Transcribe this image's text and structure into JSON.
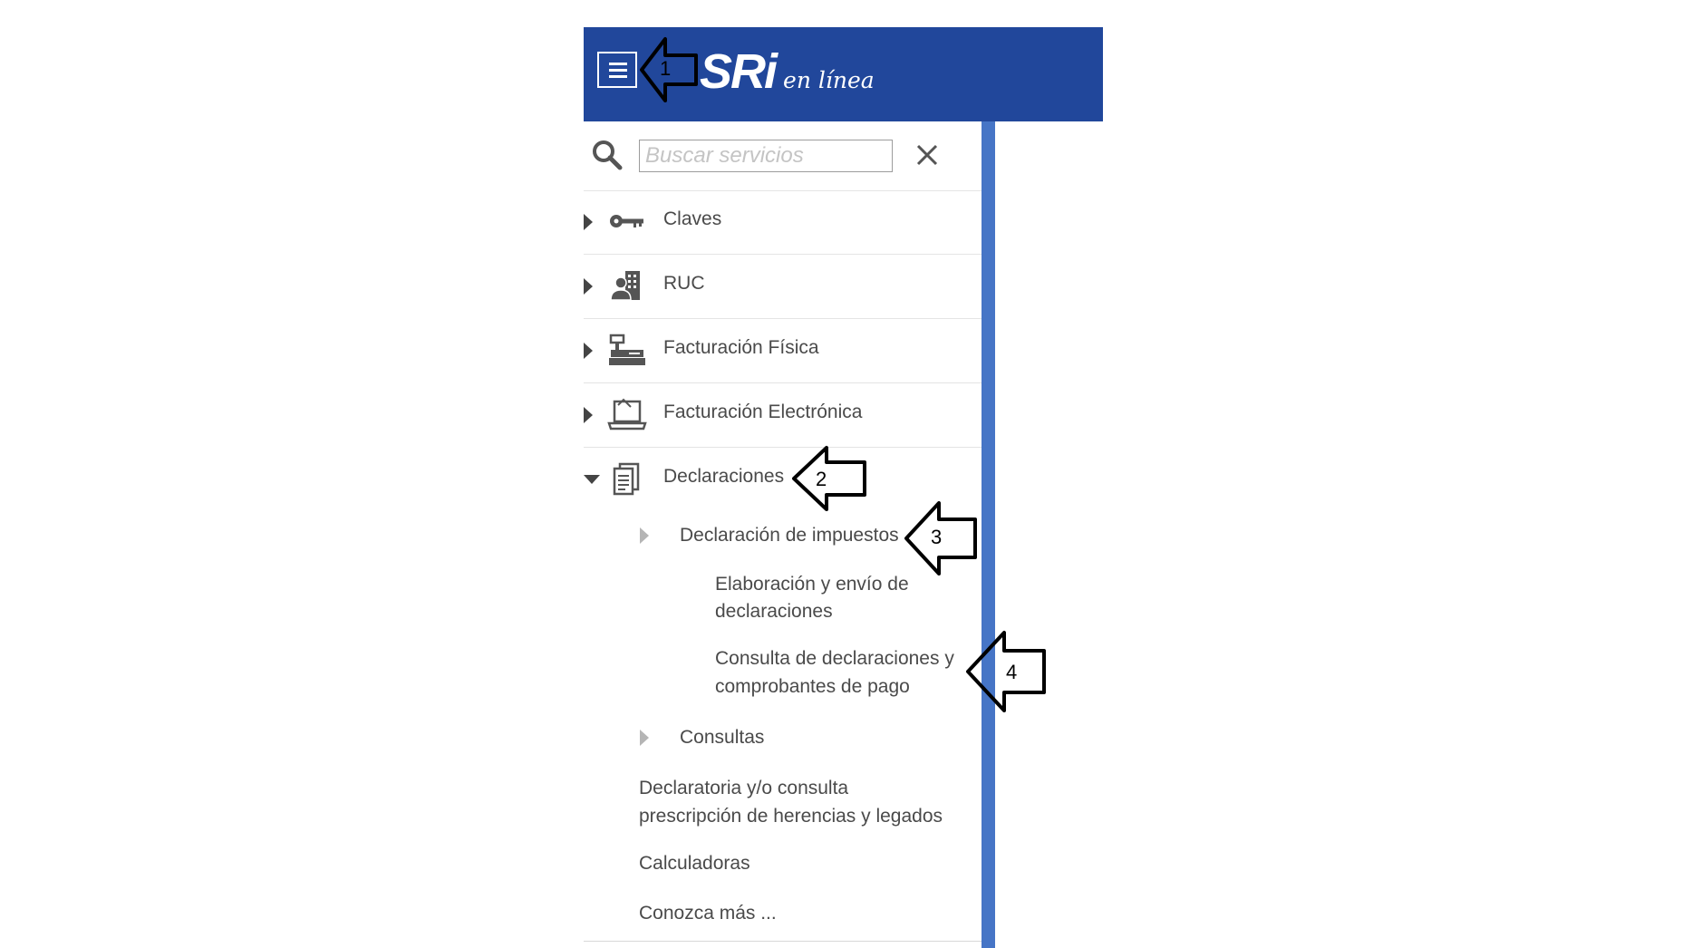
{
  "header": {
    "logo_main": "SRi",
    "logo_sub": "en línea",
    "menu_icon": "hamburger-menu-icon",
    "background_color": "#21479b"
  },
  "search": {
    "placeholder": "Buscar servicios",
    "value": "",
    "search_icon": "search-icon",
    "close_icon": "close-icon"
  },
  "menu": {
    "items": [
      {
        "label": "Claves",
        "icon": "key-icon",
        "expanded": false
      },
      {
        "label": "RUC",
        "icon": "person-building-icon",
        "expanded": false
      },
      {
        "label": "Facturación Física",
        "icon": "printer-icon",
        "expanded": false
      },
      {
        "label": "Facturación Electrónica",
        "icon": "laptop-icon",
        "expanded": false
      },
      {
        "label": "Declaraciones",
        "icon": "document-icon",
        "expanded": true
      }
    ],
    "declaraciones_sub": {
      "declaracion_impuestos": "Declaración de impuestos",
      "elaboracion_line1": "Elaboración y envío de",
      "elaboracion_line2": "declaraciones",
      "consulta_line1": "Consulta de declaraciones y",
      "consulta_line2": "comprobantes de pago",
      "consultas": "Consultas",
      "declaratoria_line1": "Declaratoria y/o consulta",
      "declaratoria_line2": "prescripción de herencias y legados",
      "calculadoras": "Calculadoras",
      "conozca": "Conozca más ..."
    }
  },
  "annotations": {
    "arrow1": "1",
    "arrow2": "2",
    "arrow3": "3",
    "arrow4": "4"
  },
  "colors": {
    "header_blue": "#21479b",
    "scroll_bar_blue": "#4675c6",
    "text_gray": "#4a4a4a"
  }
}
